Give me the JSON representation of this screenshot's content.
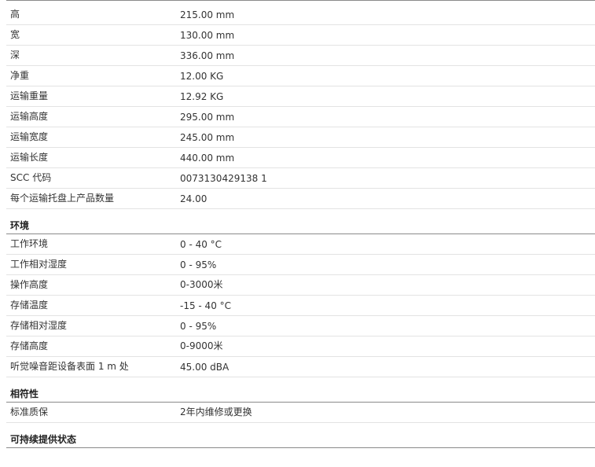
{
  "physical_rows": [
    {
      "label": "高",
      "value": "215.00 mm"
    },
    {
      "label": "宽",
      "value": "130.00 mm"
    },
    {
      "label": "深",
      "value": "336.00 mm"
    },
    {
      "label": "净重",
      "value": "12.00 KG"
    },
    {
      "label": "运输重量",
      "value": "12.92 KG"
    },
    {
      "label": "运输高度",
      "value": "295.00 mm"
    },
    {
      "label": "运输宽度",
      "value": "245.00 mm"
    },
    {
      "label": "运输长度",
      "value": "440.00 mm"
    },
    {
      "label": "SCC 代码",
      "value": "0073130429138 1"
    },
    {
      "label": "每个运输托盘上产品数量",
      "value": "24.00"
    }
  ],
  "environment": {
    "title": "环境",
    "rows": [
      {
        "label": "工作环境",
        "value": "0 - 40 °C"
      },
      {
        "label": "工作相对湿度",
        "value": "0 - 95%"
      },
      {
        "label": "操作高度",
        "value": "0-3000米"
      },
      {
        "label": "存储温度",
        "value": "-15 - 40 °C"
      },
      {
        "label": "存储相对湿度",
        "value": "0 - 95%"
      },
      {
        "label": "存储高度",
        "value": "0-9000米"
      },
      {
        "label": "听觉噪音距设备表面 1 m 处",
        "value": "45.00 dBA"
      }
    ]
  },
  "compliance": {
    "title": "相符性",
    "rows": [
      {
        "label": "标准质保",
        "value": "2年内维修或更换"
      }
    ]
  },
  "sustainability": {
    "title": "可持续提供状态"
  }
}
